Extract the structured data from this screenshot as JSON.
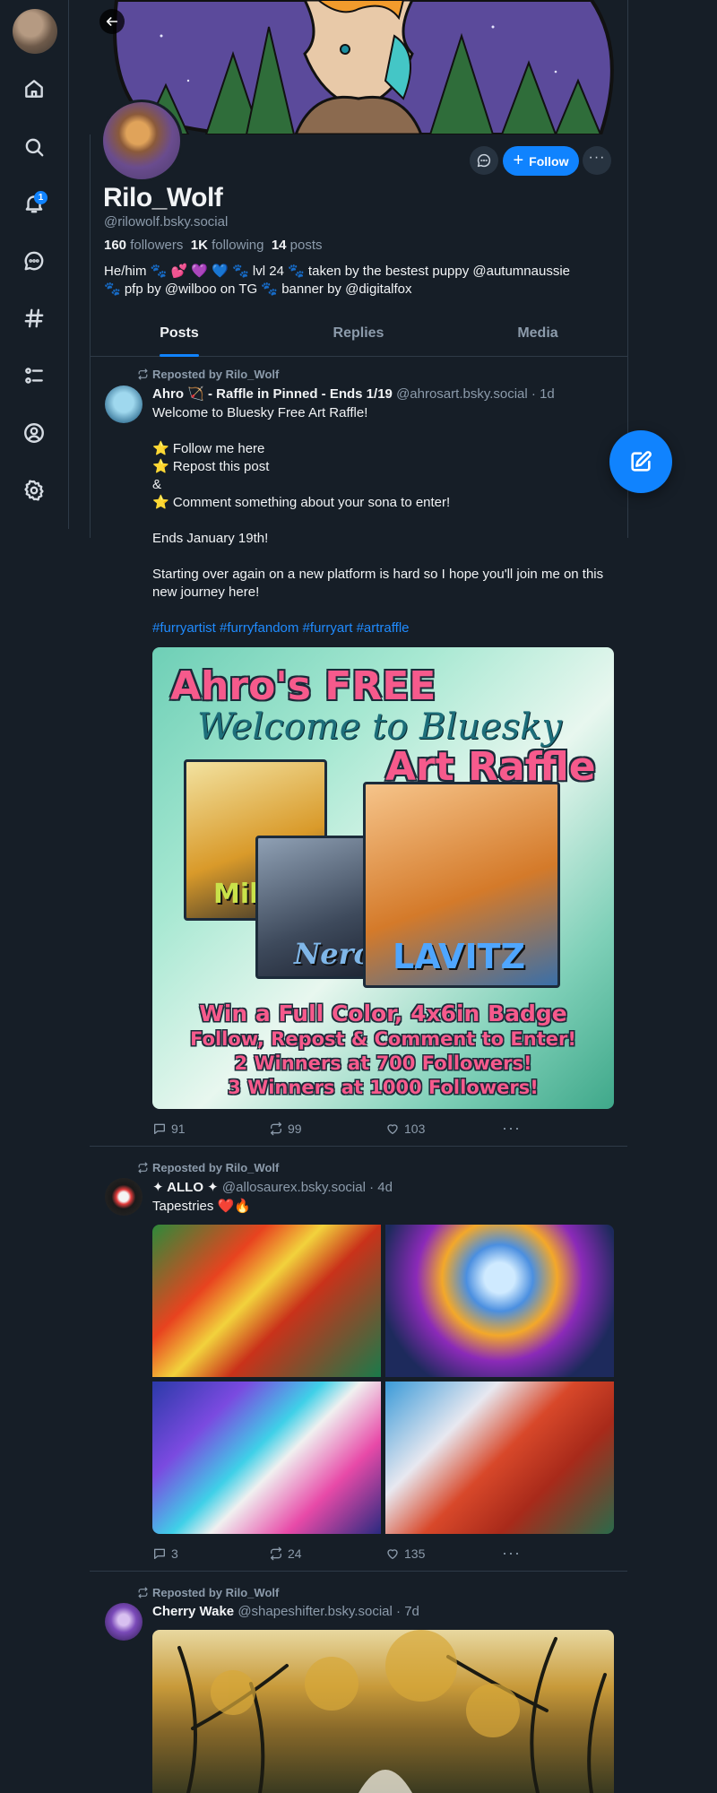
{
  "nav": {
    "notification_count": "1",
    "items": [
      "home-icon",
      "search-icon",
      "bell-icon",
      "chat-icon",
      "hashtag-icon",
      "list-icon",
      "profile-icon",
      "gear-icon"
    ]
  },
  "profile": {
    "display_name": "Rilo_Wolf",
    "handle": "@rilowolf.bsky.social",
    "followers_count": "160",
    "followers_label": "followers",
    "following_count": "1K",
    "following_label": "following",
    "posts_count": "14",
    "posts_label": "posts",
    "bio": "He/him 🐾 💕 💜 💙 🐾 lvl 24 🐾 taken by the bestest puppy @autumnaussie\n🐾 pfp by @wilboo on TG 🐾 banner by @digitalfox",
    "follow_label": "Follow"
  },
  "tabs": [
    {
      "label": "Posts",
      "active": true
    },
    {
      "label": "Replies",
      "active": false
    },
    {
      "label": "Media",
      "active": false
    }
  ],
  "posts": [
    {
      "repost_label": "Reposted by Rilo_Wolf",
      "author_name": "Ahro 🏹 - Raffle in Pinned - Ends 1/19",
      "author_handle": "@ahrosart.bsky.social",
      "time": "· 1d",
      "text": "Welcome to Bluesky Free Art Raffle!\n\n⭐ Follow me here\n⭐ Repost this post\n&\n⭐ Comment something about your sona to enter!\n\nEnds January 19th!\n\nStarting over again on a new platform is hard so I hope you'll join me on this new journey here!",
      "hashtags": "#furryartist #furryfandom #furryart #artraffle",
      "image_text": {
        "title": "Ahro's FREE",
        "welcome": "Welcome to Bluesky",
        "subtitle": "Art Raffle",
        "name1": "Miky",
        "name2": "Nero",
        "name3": "LAVITZ",
        "line1": "Win a Full Color, 4x6in Badge",
        "line2": "Follow, Repost & Comment to Enter!",
        "line3": "2 Winners at 700 Followers!",
        "line4": "3 Winners at 1000 Followers!"
      },
      "replies": "91",
      "reposts": "99",
      "likes": "103"
    },
    {
      "repost_label": "Reposted by Rilo_Wolf",
      "author_name": "✦ ALLO ✦",
      "author_handle": "@allosaurex.bsky.social",
      "time": "· 4d",
      "text": "Tapestries ❤️🔥",
      "replies": "3",
      "reposts": "24",
      "likes": "135"
    },
    {
      "repost_label": "Reposted by Rilo_Wolf",
      "author_name": "Cherry Wake",
      "author_handle": "@shapeshifter.bsky.social",
      "time": "· 7d"
    }
  ],
  "colors": {
    "background": "#161e27",
    "accent": "#1083fe",
    "hashtag": "#208bfe",
    "muted_text": "#8c9bab"
  }
}
